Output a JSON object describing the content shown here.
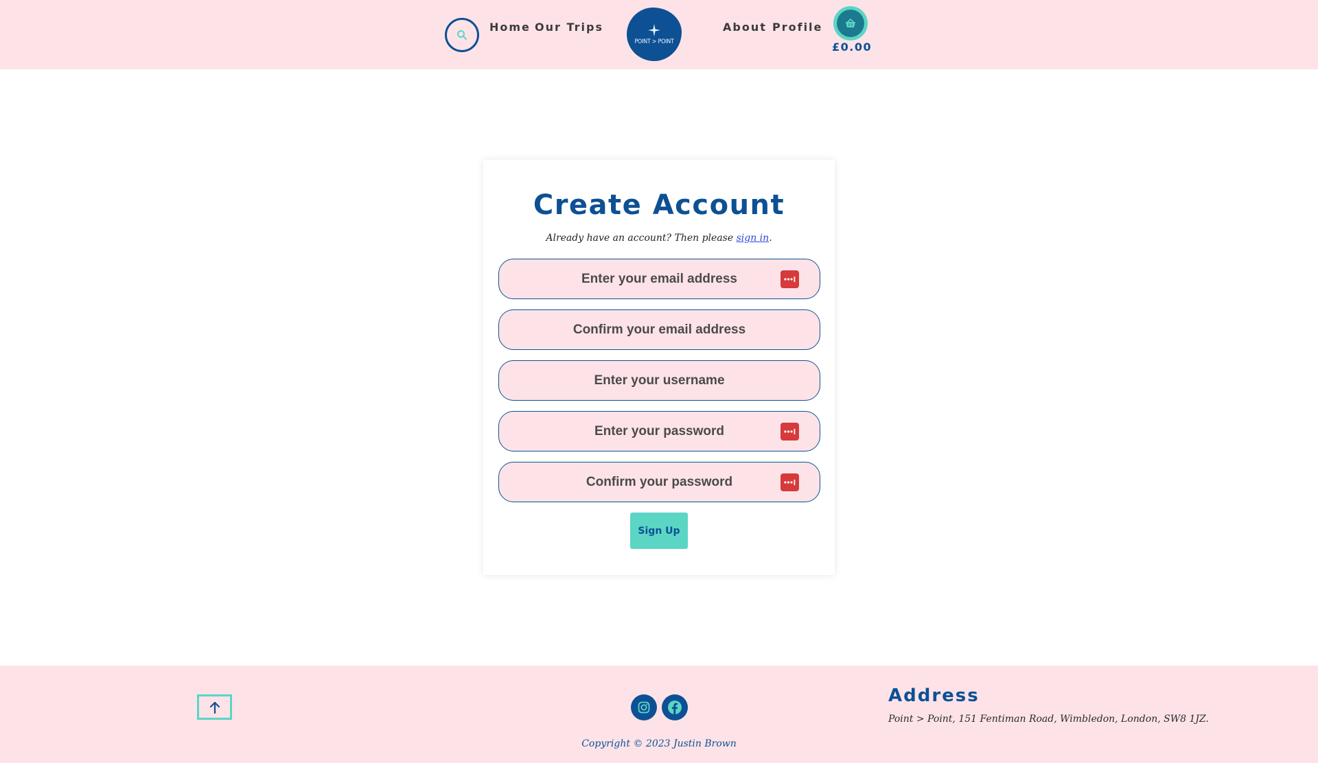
{
  "header": {
    "nav_left": [
      "Home",
      "Our Trips"
    ],
    "nav_right": [
      "About",
      "Profile"
    ],
    "logo_text": "POINT > POINT",
    "basket_total": "£0.00"
  },
  "form": {
    "title": "Create Account",
    "signin_prompt": "Already have an account? Then please",
    "signin_link": "sign in",
    "signin_suffix": ".",
    "fields": [
      {
        "placeholder": "Enter your email address",
        "password_icon": true
      },
      {
        "placeholder": "Confirm your email address",
        "password_icon": false
      },
      {
        "placeholder": "Enter your username",
        "password_icon": false
      },
      {
        "placeholder": "Enter your password",
        "password_icon": true
      },
      {
        "placeholder": "Confirm your password",
        "password_icon": true
      }
    ],
    "submit_label": "Sign Up"
  },
  "footer": {
    "copyright": "Copyright © 2023 Justin Brown",
    "address_title": "Address",
    "address_text": "Point > Point, 151 Fentiman Road, Wimbledon, London, SW8 1JZ."
  },
  "colors": {
    "brand_blue": "#0d5094",
    "accent_teal": "#5bd5c4",
    "pink_bg": "#fde3e8",
    "password_icon_red": "#d63a3a"
  },
  "icons": [
    "search-icon",
    "basket-icon",
    "compass-icon",
    "password-manager-icon",
    "arrow-up-icon",
    "instagram-icon",
    "facebook-icon"
  ]
}
